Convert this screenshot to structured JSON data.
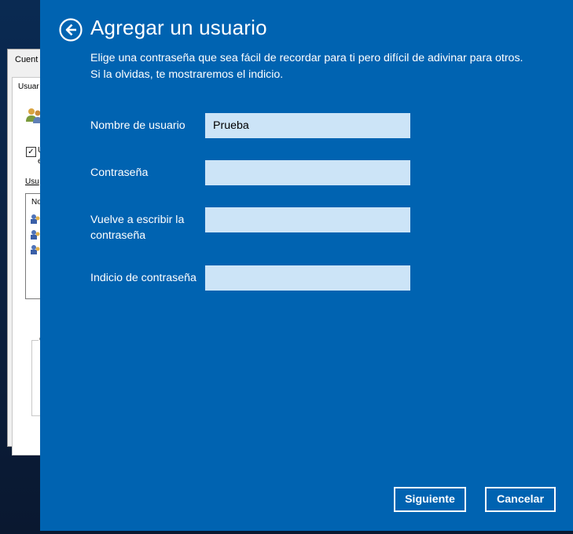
{
  "background_window": {
    "title": "Cuent",
    "tab": "Usuar",
    "checkbox_checked": true,
    "checkbox_mark": "✓",
    "checkbox_label_line1": "U",
    "checkbox_label_line2": "e",
    "group_label": "Usu",
    "list_header": "No",
    "groupbox_label": "Co"
  },
  "dialog": {
    "title": "Agregar un usuario",
    "description": "Elige una contraseña que sea fácil de recordar para ti pero difícil de adivinar para otros. Si la olvidas, te mostraremos el indicio.",
    "back_icon": "back-arrow-circle-icon",
    "fields": [
      {
        "label": "Nombre de usuario",
        "value": "Prueba"
      },
      {
        "label": "Contraseña",
        "value": ""
      },
      {
        "label": "Vuelve a escribir la contraseña",
        "value": ""
      },
      {
        "label": "Indicio de contraseña",
        "value": ""
      }
    ],
    "buttons": {
      "next_label": "Siguiente",
      "cancel_label": "Cancelar"
    }
  },
  "colors": {
    "dialog_background": "#0063b1",
    "input_background": "#cce4f7",
    "text": "#ffffff"
  }
}
